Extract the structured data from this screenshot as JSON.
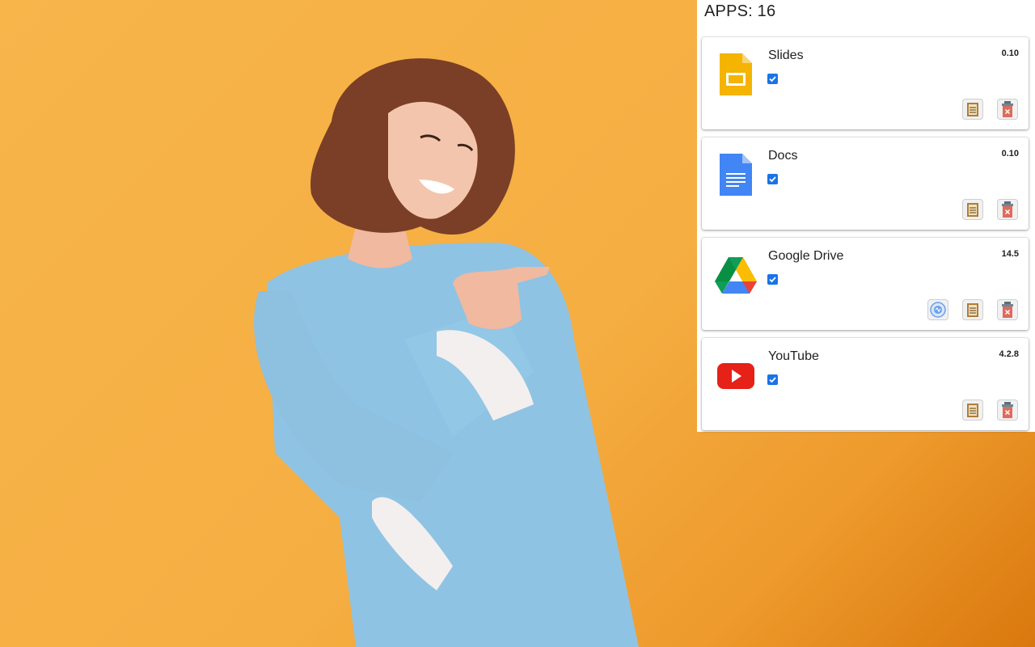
{
  "panel": {
    "title": "APPS: 16"
  },
  "apps": [
    {
      "name": "Slides",
      "version": "0.10",
      "enabled": true,
      "icon": "slides-icon",
      "actions": [
        "details-icon",
        "delete-icon"
      ]
    },
    {
      "name": "Docs",
      "version": "0.10",
      "enabled": true,
      "icon": "docs-icon",
      "actions": [
        "details-icon",
        "delete-icon"
      ]
    },
    {
      "name": "Google Drive",
      "version": "14.5",
      "enabled": true,
      "icon": "drive-icon",
      "actions": [
        "service-worker-icon",
        "details-icon",
        "delete-icon"
      ]
    },
    {
      "name": "YouTube",
      "version": "4.2.8",
      "enabled": true,
      "icon": "youtube-icon",
      "actions": [
        "details-icon",
        "delete-icon"
      ]
    }
  ],
  "colors": {
    "background": "#f5ae42",
    "checkbox": "#1a73e8",
    "delete": "#e06b5c"
  }
}
